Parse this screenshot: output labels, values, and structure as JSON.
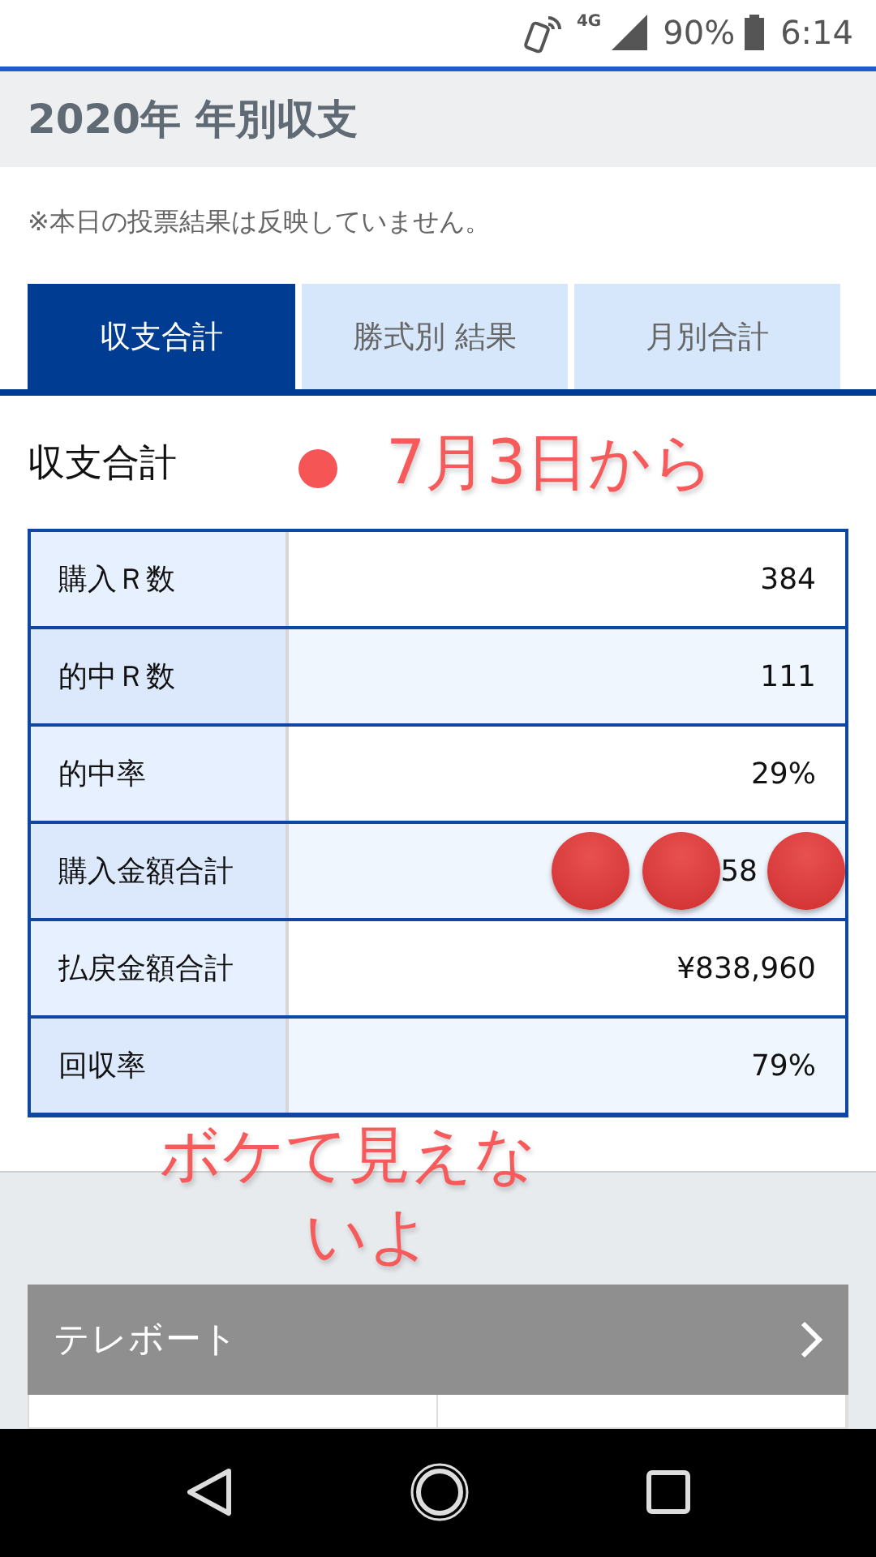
{
  "status_bar": {
    "network": "4G",
    "battery": "90%",
    "time": "6:14"
  },
  "header": {
    "title": "2020年 年別収支"
  },
  "note": "※本日の投票結果は反映していません。",
  "tabs": [
    {
      "label": "収支合計",
      "selected": true
    },
    {
      "label": "勝式別 結果",
      "selected": false
    },
    {
      "label": "月別合計",
      "selected": false
    }
  ],
  "section": {
    "title": "収支合計"
  },
  "table": {
    "rows": [
      {
        "label": "購入Ｒ数",
        "value": "384"
      },
      {
        "label": "的中Ｒ数",
        "value": "111"
      },
      {
        "label": "的中率",
        "value": "29%"
      },
      {
        "label": "購入金額合計",
        "value": "58",
        "hidden_by_dots": true
      },
      {
        "label": "払戻金額合計",
        "value": "¥838,960"
      },
      {
        "label": "回収率",
        "value": "79%"
      }
    ]
  },
  "annotations": [
    {
      "kind": "caption",
      "text": "7月3日から"
    },
    {
      "kind": "note",
      "lines": [
        "ボケて見えな",
        "いよ"
      ]
    }
  ],
  "link_bar": {
    "label": "テレボート"
  }
}
